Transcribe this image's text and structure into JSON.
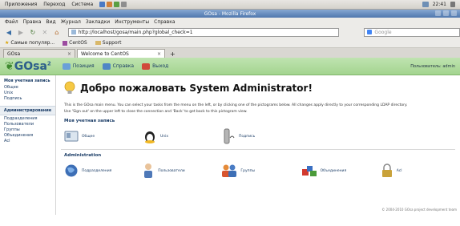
{
  "system_panel": {
    "menus": [
      "Приложения",
      "Переход",
      "Система"
    ],
    "clock": "22:41"
  },
  "window": {
    "title": "GOsa - Mozilla Firefox"
  },
  "firefox_menu": [
    "Файл",
    "Правка",
    "Вид",
    "Журнал",
    "Закладки",
    "Инструменты",
    "Справка"
  ],
  "navbar": {
    "url": "http://localhost/gosa/main.php?global_check=1",
    "search_placeholder": "Google"
  },
  "bookmarks": [
    "Самые популяр...",
    "CentOS",
    "Support"
  ],
  "tabs": [
    {
      "label": "GOsa",
      "active": false
    },
    {
      "label": "Welcome to CentOS",
      "active": true
    }
  ],
  "gosa_header": {
    "logo": "GOsa",
    "logo_super": "2",
    "links": [
      "Позиция",
      "Справка",
      "Выход"
    ],
    "user": "Пользователь: admin"
  },
  "sidebar": {
    "my_account_heading": "Моя учетная запись",
    "my_account_items": [
      "Общее",
      "Unix",
      "Подпись"
    ],
    "admin_heading": "Администрирование",
    "admin_items": [
      "Подразделения",
      "Пользователи",
      "Группы",
      "Объединения",
      "Acl"
    ]
  },
  "main": {
    "welcome_title": "Добро пожаловать System Administrator!",
    "intro_line1": "This is the GOsa main menu. You can select your tasks from the menu on the left, or by clicking one of the pictograms below. All changes apply directly to your corresponding LDAP directory.",
    "intro_line2": "Use 'Sign out' on the upper left to close the connection and 'Back' to get back to this pictogram view.",
    "my_account_section": "Моя учетная запись",
    "my_account_icons": [
      "Общее",
      "Unix",
      "Подпись"
    ],
    "admin_section": "Administration",
    "admin_icons": [
      "Подразделения",
      "Пользователи",
      "Группы",
      "Объединения",
      "Acl"
    ],
    "footer": "© 2004-2010 GOsa project development team"
  }
}
